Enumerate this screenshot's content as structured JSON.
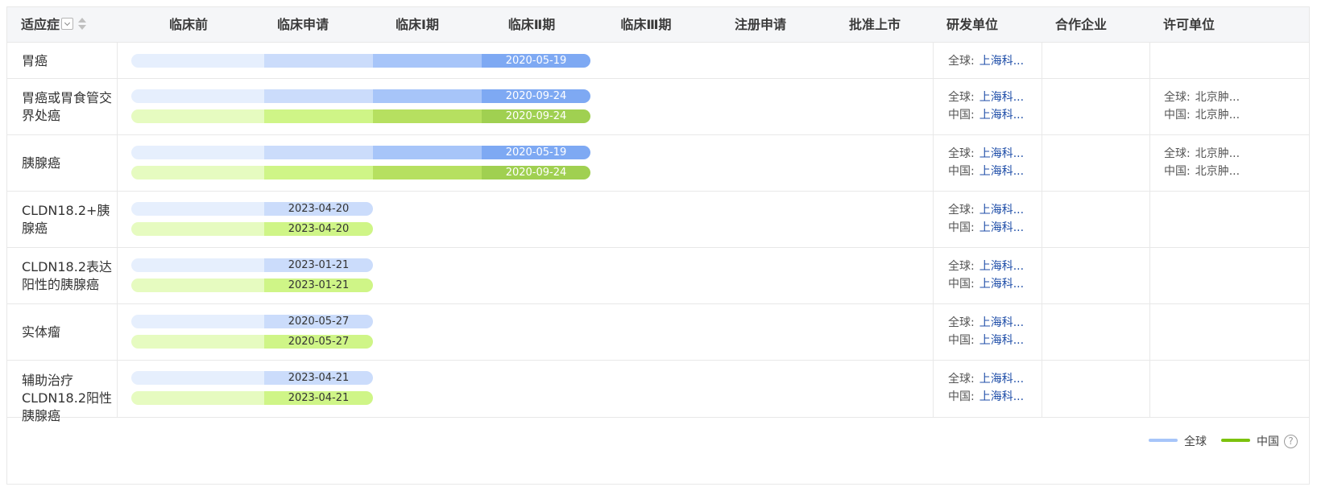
{
  "header": {
    "indication": "适应症",
    "phases": [
      "临床前",
      "临床申请",
      "临床Ⅰ期",
      "临床Ⅱ期",
      "临床Ⅲ期",
      "注册申请",
      "批准上市"
    ],
    "developer": "研发单位",
    "partner": "合作企业",
    "licensor": "许可单位"
  },
  "colors": {
    "global": [
      "#e6effd",
      "#cbdcfb",
      "#a7c5f9",
      "#7ea9f3"
    ],
    "china": [
      "#e6fbc0",
      "#cff587",
      "#b6e060",
      "#a0d051"
    ],
    "global_text": "#ffffff",
    "china_text": "#ffffff",
    "early_text": "#333333",
    "org_link": "#1f4ea8"
  },
  "rows": [
    {
      "indication": "胃癌",
      "bars": [
        {
          "region": "global",
          "phase_index": 3,
          "date": "2020-05-19"
        }
      ],
      "developer": [
        {
          "key": "全球:",
          "value": "上海科..."
        }
      ],
      "licensor": []
    },
    {
      "indication": "胃癌或胃食管交界处癌",
      "bars": [
        {
          "region": "global",
          "phase_index": 3,
          "date": "2020-09-24"
        },
        {
          "region": "china",
          "phase_index": 3,
          "date": "2020-09-24"
        }
      ],
      "developer": [
        {
          "key": "全球:",
          "value": "上海科..."
        },
        {
          "key": "中国:",
          "value": "上海科..."
        }
      ],
      "licensor": [
        {
          "key": "全球:",
          "value": "北京肿..."
        },
        {
          "key": "中国:",
          "value": "北京肿..."
        }
      ]
    },
    {
      "indication": "胰腺癌",
      "bars": [
        {
          "region": "global",
          "phase_index": 3,
          "date": "2020-05-19"
        },
        {
          "region": "china",
          "phase_index": 3,
          "date": "2020-09-24"
        }
      ],
      "developer": [
        {
          "key": "全球:",
          "value": "上海科..."
        },
        {
          "key": "中国:",
          "value": "上海科..."
        }
      ],
      "licensor": [
        {
          "key": "全球:",
          "value": "北京肿..."
        },
        {
          "key": "中国:",
          "value": "北京肿..."
        }
      ]
    },
    {
      "indication": "CLDN18.2+胰腺癌",
      "bars": [
        {
          "region": "global",
          "phase_index": 1,
          "date": "2023-04-20"
        },
        {
          "region": "china",
          "phase_index": 1,
          "date": "2023-04-20"
        }
      ],
      "developer": [
        {
          "key": "全球:",
          "value": "上海科..."
        },
        {
          "key": "中国:",
          "value": "上海科..."
        }
      ],
      "licensor": []
    },
    {
      "indication": "CLDN18.2表达阳性的胰腺癌",
      "bars": [
        {
          "region": "global",
          "phase_index": 1,
          "date": "2023-01-21"
        },
        {
          "region": "china",
          "phase_index": 1,
          "date": "2023-01-21"
        }
      ],
      "developer": [
        {
          "key": "全球:",
          "value": "上海科..."
        },
        {
          "key": "中国:",
          "value": "上海科..."
        }
      ],
      "licensor": []
    },
    {
      "indication": "实体瘤",
      "bars": [
        {
          "region": "global",
          "phase_index": 1,
          "date": "2020-05-27"
        },
        {
          "region": "china",
          "phase_index": 1,
          "date": "2020-05-27"
        }
      ],
      "developer": [
        {
          "key": "全球:",
          "value": "上海科..."
        },
        {
          "key": "中国:",
          "value": "上海科..."
        }
      ],
      "licensor": []
    },
    {
      "indication": "辅助治疗CLDN18.2阳性胰腺癌",
      "bars": [
        {
          "region": "global",
          "phase_index": 1,
          "date": "2023-04-21"
        },
        {
          "region": "china",
          "phase_index": 1,
          "date": "2023-04-21"
        }
      ],
      "developer": [
        {
          "key": "全球:",
          "value": "上海科..."
        },
        {
          "key": "中国:",
          "value": "上海科..."
        }
      ],
      "licensor": []
    }
  ],
  "legend": {
    "global": "全球",
    "china": "中国",
    "help": "?"
  }
}
